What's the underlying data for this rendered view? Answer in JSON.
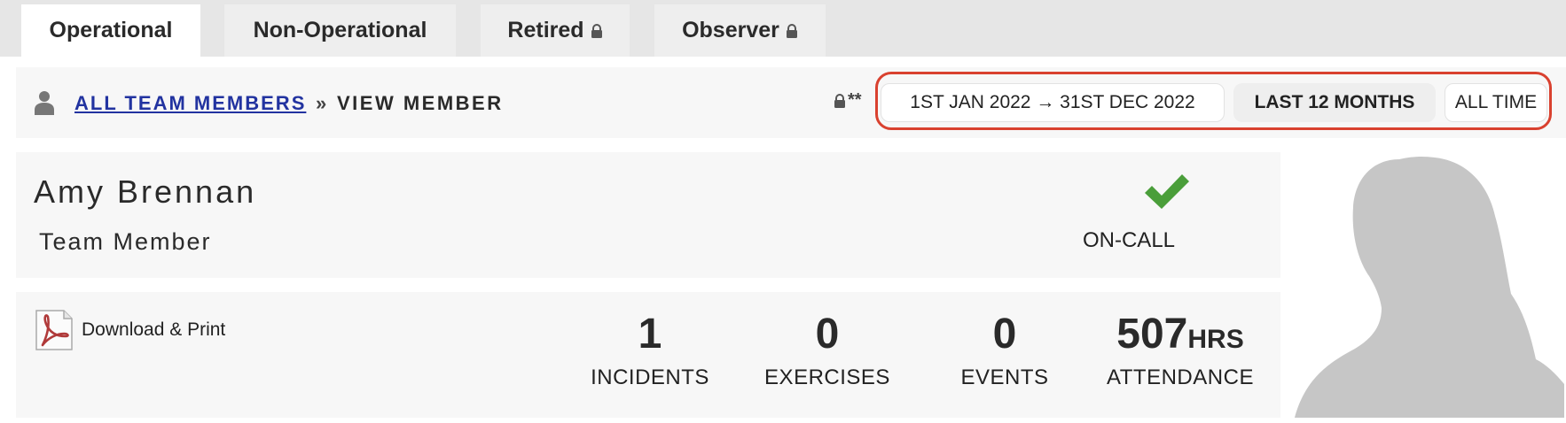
{
  "tabs": [
    {
      "label": "Operational",
      "active": true,
      "locked": false
    },
    {
      "label": "Non-Operational",
      "active": false,
      "locked": false
    },
    {
      "label": "Retired",
      "active": false,
      "locked": true
    },
    {
      "label": "Observer",
      "active": false,
      "locked": true
    }
  ],
  "breadcrumb": {
    "parent_label": "ALL TEAM MEMBERS",
    "separator": "»",
    "current_label": "VIEW MEMBER"
  },
  "lock_indicator": "**",
  "date_ranges": {
    "custom_label": "1ST JAN 2022 → 31ST DEC 2022",
    "last_12_label": "LAST 12 MONTHS",
    "all_time_label": "ALL TIME",
    "selected": "LAST 12 MONTHS",
    "highlight_color": "#d9412f"
  },
  "member": {
    "name": "Amy Brennan",
    "role": "Team Member",
    "status_label": "ON-CALL",
    "status_icon": "check-icon",
    "status_color": "#4a9e3a"
  },
  "download": {
    "label": "Download & Print",
    "icon": "pdf-icon"
  },
  "stats": {
    "incidents": {
      "value": "1",
      "label": "INCIDENTS"
    },
    "exercises": {
      "value": "0",
      "label": "EXERCISES"
    },
    "events": {
      "value": "0",
      "label": "EVENTS"
    },
    "attendance": {
      "value": "507",
      "unit": "HRS",
      "label": "ATTENDANCE"
    }
  },
  "avatar": {
    "icon": "person-silhouette-icon"
  }
}
